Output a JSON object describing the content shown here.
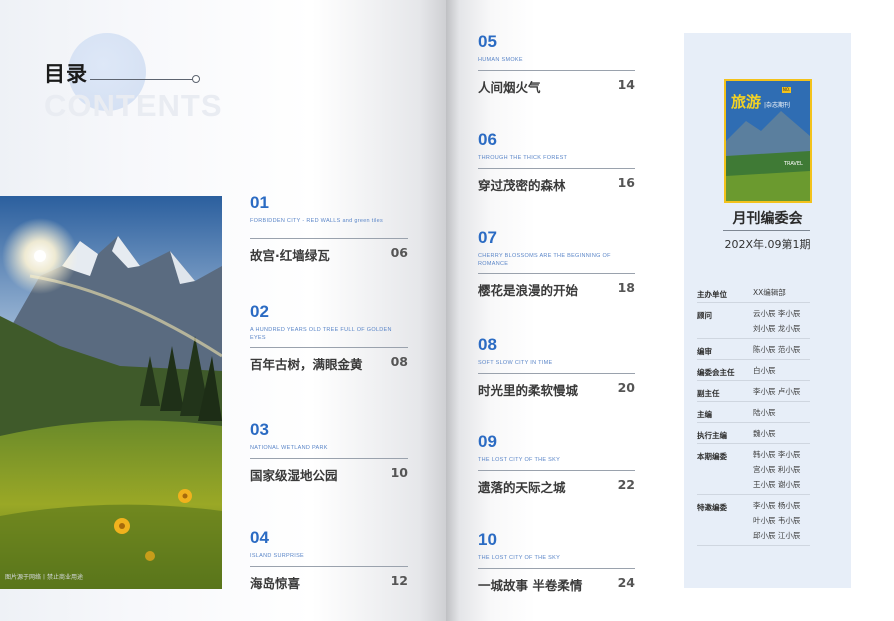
{
  "title": {
    "cn": "目录",
    "en": "CONTENTS"
  },
  "photo_credit": "图片源于网络丨禁止商业用途",
  "entries": [
    {
      "num": "01",
      "sub": "FORBIDDEN CITY - RED WALLS and green tiles",
      "title": "故宫·红墙绿瓦",
      "page": "06"
    },
    {
      "num": "02",
      "sub": "A HUNDRED YEARS OLD TREE FULL OF GOLDEN EYES",
      "title": "百年古树，满眼金黄",
      "page": "08"
    },
    {
      "num": "03",
      "sub": "NATIONAL WETLAND PARK",
      "title": "国家级湿地公园",
      "page": "10"
    },
    {
      "num": "04",
      "sub": "ISLAND SURPRISE",
      "title": "海岛惊喜",
      "page": "12"
    },
    {
      "num": "05",
      "sub": "HUMAN SMOKE",
      "title": "人间烟火气",
      "page": "14"
    },
    {
      "num": "06",
      "sub": "THROUGH THE THICK FOREST",
      "title": "穿过茂密的森林",
      "page": "16"
    },
    {
      "num": "07",
      "sub": "CHERRY BLOSSOMS ARE THE BEGINNING OF ROMANCE",
      "title": "樱花是浪漫的开始",
      "page": "18"
    },
    {
      "num": "08",
      "sub": "SOFT SLOW CITY IN TIME",
      "title": "时光里的柔软慢城",
      "page": "20"
    },
    {
      "num": "09",
      "sub": "THE LOST CITY OF THE SKY",
      "title": "遗落的天际之城",
      "page": "22"
    },
    {
      "num": "10",
      "sub": "THE LOST CITY OF THE SKY",
      "title": "一城故事 半卷柔情",
      "page": "24"
    }
  ],
  "cover": {
    "title": "旅游",
    "sub": "|杂志期刊",
    "tag": "NO.",
    "travel": "TRAVEL"
  },
  "committee": {
    "heading": "月刊编委会",
    "issue": "202X年.09第1期"
  },
  "masthead": [
    {
      "label": "主办单位",
      "lines": [
        "XX编辑部"
      ]
    },
    {
      "label": "顾问",
      "lines": [
        "云小辰  李小辰",
        "刘小辰  龙小辰"
      ]
    },
    {
      "label": "编审",
      "lines": [
        "陈小辰  范小辰"
      ]
    },
    {
      "label": "编委会主任",
      "lines": [
        "白小辰"
      ]
    },
    {
      "label": "副主任",
      "lines": [
        "李小辰  卢小辰"
      ]
    },
    {
      "label": "主编",
      "lines": [
        "陆小辰"
      ]
    },
    {
      "label": "执行主编",
      "lines": [
        "魏小辰"
      ]
    },
    {
      "label": "本期编委",
      "lines": [
        "韩小辰  李小辰",
        "宫小辰  利小辰",
        "王小辰  谢小辰"
      ]
    },
    {
      "label": "特邀编委",
      "lines": [
        "李小辰  杨小辰",
        "叶小辰  韦小辰",
        "邱小辰  江小辰"
      ]
    }
  ],
  "colors": {
    "accent": "#2b6bc3",
    "panel": "#e7eef8",
    "cover_border": "#f3c21b"
  }
}
